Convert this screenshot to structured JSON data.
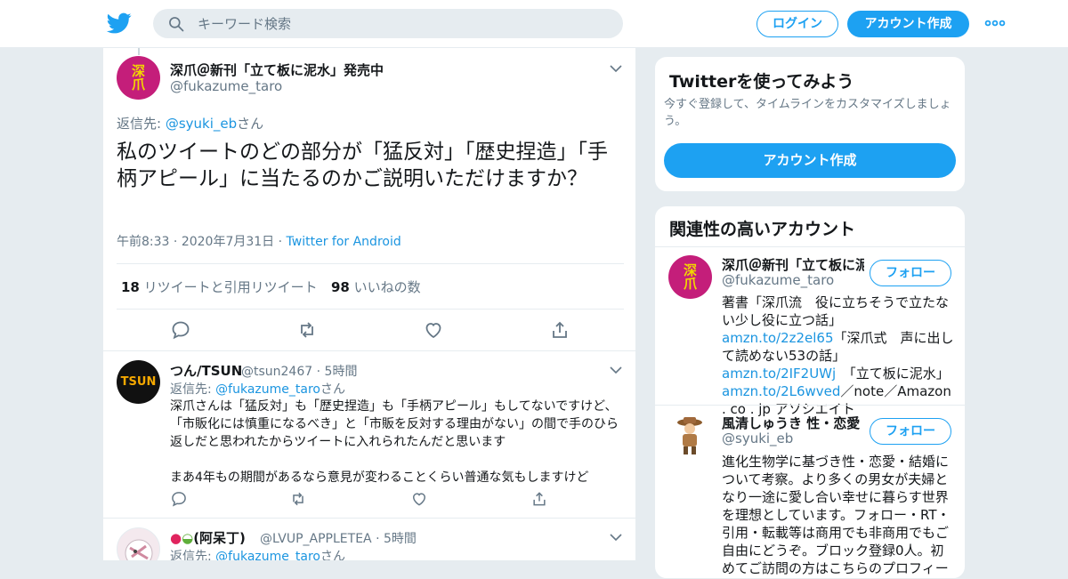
{
  "search": {
    "placeholder": "キーワード検索"
  },
  "header": {
    "login_label": "ログイン",
    "signup_label": "アカウント作成"
  },
  "colors": {
    "accent": "#1da1f2",
    "link": "#1b95e0",
    "muted": "#657786",
    "background": "#e6ecf0"
  },
  "main_tweet": {
    "name": "深爪＠新刊「立て板に泥水」発売中",
    "handle": "@fukazume_taro",
    "reply_prefix": "返信先: ",
    "reply_to": "@syuki_eb",
    "reply_suffix": "さん",
    "text": "私のツイートのどの部分が「猛反対」「歴史捏造」「手柄アピール」に当たるのかご説明いただけますか？",
    "time": "午前8:33",
    "date": "2020年7月31日",
    "source": "Twitter for Android",
    "retweets_count": "18",
    "retweets_label": "リツイートと引用リツイート",
    "likes_count": "98",
    "likes_label": "いいねの数"
  },
  "replies": [
    {
      "name": "つん/TSUN",
      "handle": "@tsun2467",
      "time": "5時間",
      "reply_prefix": "返信先: ",
      "reply_to": "@fukazume_taro",
      "reply_suffix": "さん",
      "text_p1": "深爪さんは「猛反対」も「歴史捏造」も「手柄アピール」もしてないですけど、「市販化には慎重になるべき」と「市販を反対する理由がない」の間で手のひら返しだと思われたからツイートに入れられたんだと思います",
      "text_p2": "まあ4年もの期間があるなら意見が変わることくらい普通な気もしますけど",
      "avatar_text": "TSUN"
    },
    {
      "name": "(阿呆丁)",
      "handle": "@LVUP_APPLETEA",
      "time": "5時間",
      "reply_prefix": "返信先: ",
      "reply_to": "@fukazume_taro",
      "reply_suffix": "さん"
    }
  ],
  "sidebar": {
    "signup_card": {
      "title": "Twitterを使ってみよう",
      "subtitle": "今すぐ登録して、タイムラインをカスタマイズしましょう。",
      "button_label": "アカウント作成"
    },
    "related": {
      "title": "関連性の高いアカウント",
      "follow_label": "フォロー",
      "accounts": [
        {
          "name": "深爪＠新刊「立て板に泥水」発売中",
          "handle": "@fukazume_taro",
          "bio_1": "著書「深爪流　役に立ちそうで立たない少し役に立つ話」　",
          "link_1": "amzn.to/2z2el65",
          "bio_2": "「深爪式　声に出して読めない53の話」",
          "link_2": "amzn.to/2IF2UWj",
          "bio_3": "　「立て板に泥水」",
          "link_3": "amzn.to/2L6wved",
          "bio_4": "／note／Amazon . co . jp アソシエイト"
        },
        {
          "name": "風清しゅうき 性・恋愛・結婚",
          "handle": "@syuki_eb",
          "bio": "進化生物学に基づき性・恋愛・結婚について考察。より多くの男女が夫婦となり一途に愛し合い幸せに暮らす世界を理想としています。フォロー・RT・引用・転載等は商用でも非商用でもご自由にどうぞ。ブロック登録0人。初めてご訪問の方はこちらのプロフィール"
        }
      ]
    }
  }
}
